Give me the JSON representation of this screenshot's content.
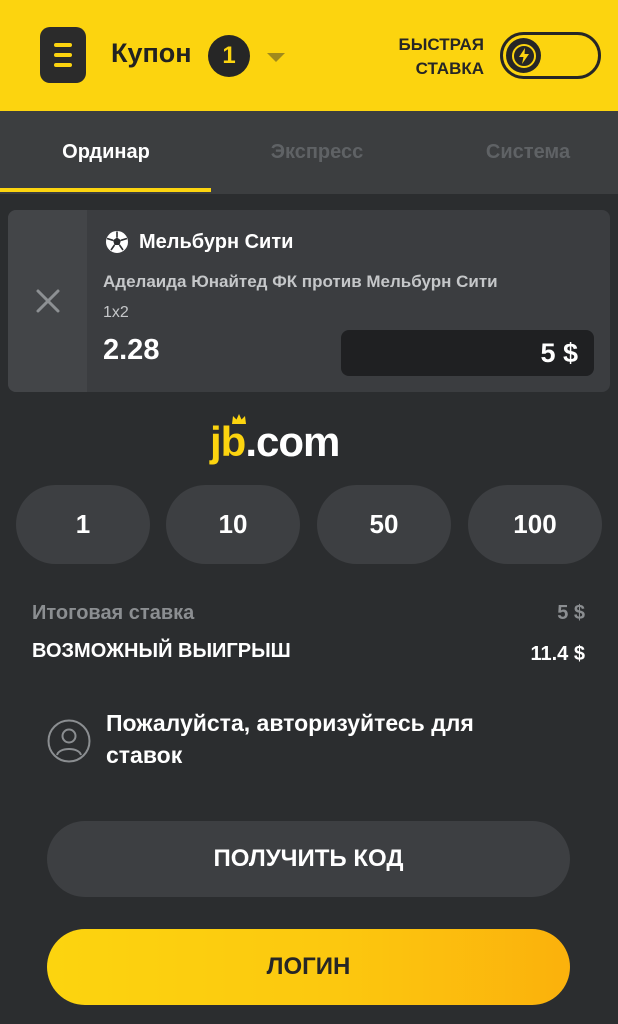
{
  "header": {
    "coupon_label": "Купон",
    "coupon_count": "1",
    "quick_bet_line1": "БЫСТРАЯ",
    "quick_bet_line2": "СТАВКА",
    "menu_icon": "menu-icon",
    "toggle_icon": "lightning-icon"
  },
  "tabs": [
    {
      "label": "Ординар",
      "active": true
    },
    {
      "label": "Экспресс",
      "active": false
    },
    {
      "label": "Система",
      "active": false
    }
  ],
  "bet": {
    "team": "Мельбурн Сити",
    "match": "Аделаида Юнайтед ФК против Мельбурн Сити",
    "market": "1x2",
    "odds": "2.28",
    "stake": "5 $",
    "remove_icon": "close-icon",
    "sport_icon": "soccer-ball-icon"
  },
  "brand": {
    "logo_jb": "jb",
    "logo_domain": ".com"
  },
  "quick_amounts": [
    "1",
    "10",
    "50",
    "100"
  ],
  "summary": {
    "total_stake_label": "Итоговая ставка",
    "total_stake_value": "5 $",
    "potential_win_label": "ВОЗМОЖНЫЙ ВЫИГРЫШ",
    "potential_win_value": "11.4 $"
  },
  "auth": {
    "message": "Пожалуйста, авторизуйтесь для ставок",
    "icon": "user-icon"
  },
  "buttons": {
    "get_code": "ПОЛУЧИТЬ КОД",
    "login": "ЛОГИН"
  },
  "colors": {
    "accent": "#fcd40f",
    "background": "#2b2d2f",
    "tab_bar": "#3c3e40",
    "card": "#3b3d40",
    "chip": "#3d3f42"
  }
}
